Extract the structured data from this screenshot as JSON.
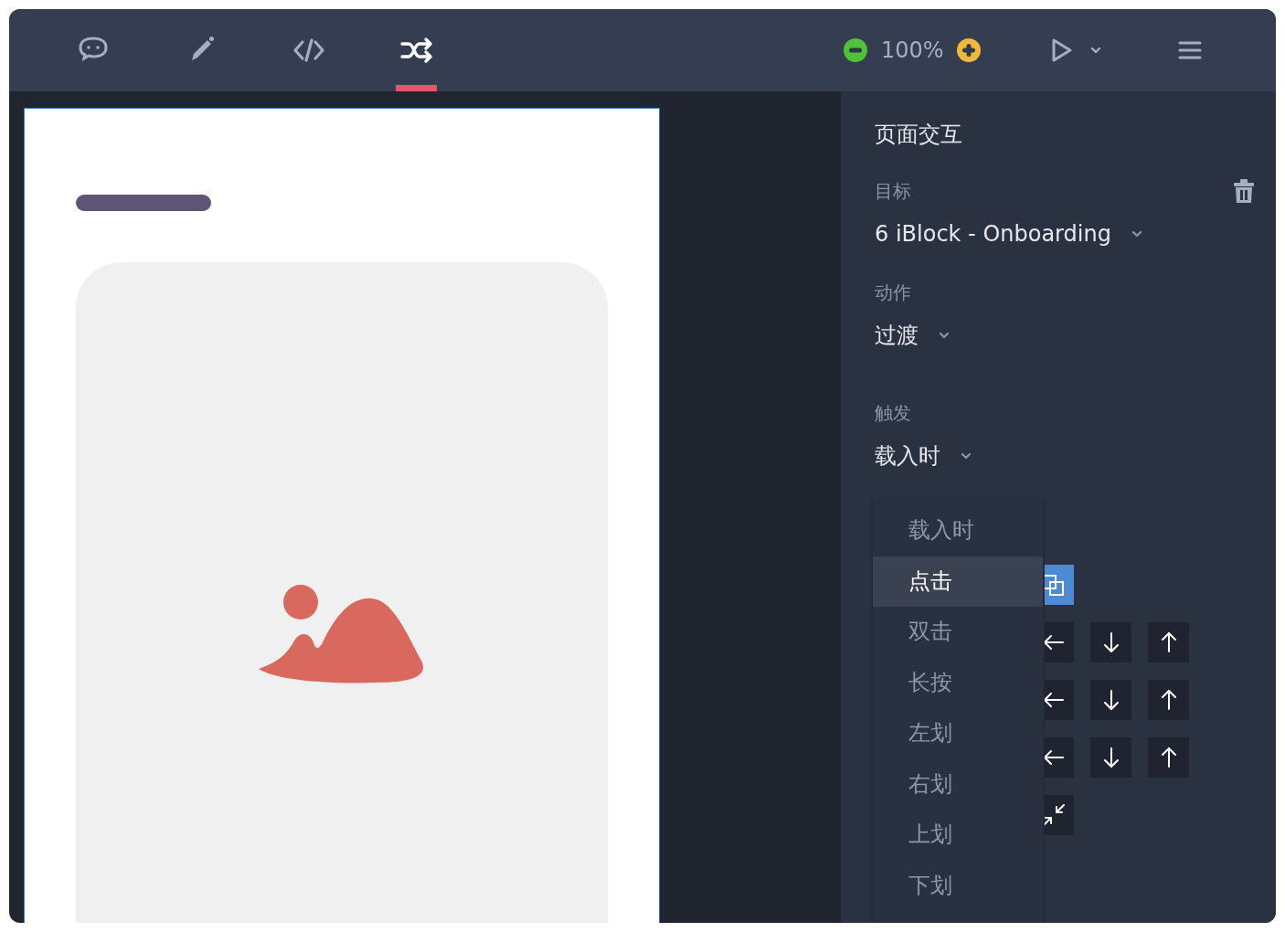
{
  "toolbar": {
    "tabs": [
      {
        "kind": "comment",
        "selected": false
      },
      {
        "kind": "pencil",
        "selected": false
      },
      {
        "kind": "code",
        "selected": false
      },
      {
        "kind": "shuffle",
        "selected": true
      }
    ],
    "zoom": "100%"
  },
  "panel": {
    "title": "页面交互",
    "fields": [
      {
        "label": "目标",
        "value": "6 iBlock - Onboarding"
      },
      {
        "label": "动作",
        "value": "过渡"
      },
      {
        "label": "触发",
        "value": "载入时"
      }
    ],
    "trigger_options": [
      {
        "label": "载入时",
        "selected": false
      },
      {
        "label": "点击",
        "selected": true
      },
      {
        "label": "双击",
        "selected": false
      },
      {
        "label": "长按",
        "selected": false
      },
      {
        "label": "左划",
        "selected": false
      },
      {
        "label": "右划",
        "selected": false
      },
      {
        "label": "上划",
        "selected": false
      },
      {
        "label": "下划",
        "selected": false
      }
    ],
    "transitions": [
      [
        {
          "kind": "overlap",
          "selected": true
        }
      ],
      [
        {
          "kind": "left",
          "selected": false
        },
        {
          "kind": "down",
          "selected": false
        },
        {
          "kind": "up",
          "selected": false
        }
      ],
      [
        {
          "kind": "left",
          "selected": false
        },
        {
          "kind": "down",
          "selected": false
        },
        {
          "kind": "up",
          "selected": false
        }
      ],
      [
        {
          "kind": "left",
          "selected": false
        },
        {
          "kind": "down",
          "selected": false
        },
        {
          "kind": "up",
          "selected": false
        }
      ],
      [
        {
          "kind": "shrink",
          "selected": false
        }
      ]
    ]
  }
}
